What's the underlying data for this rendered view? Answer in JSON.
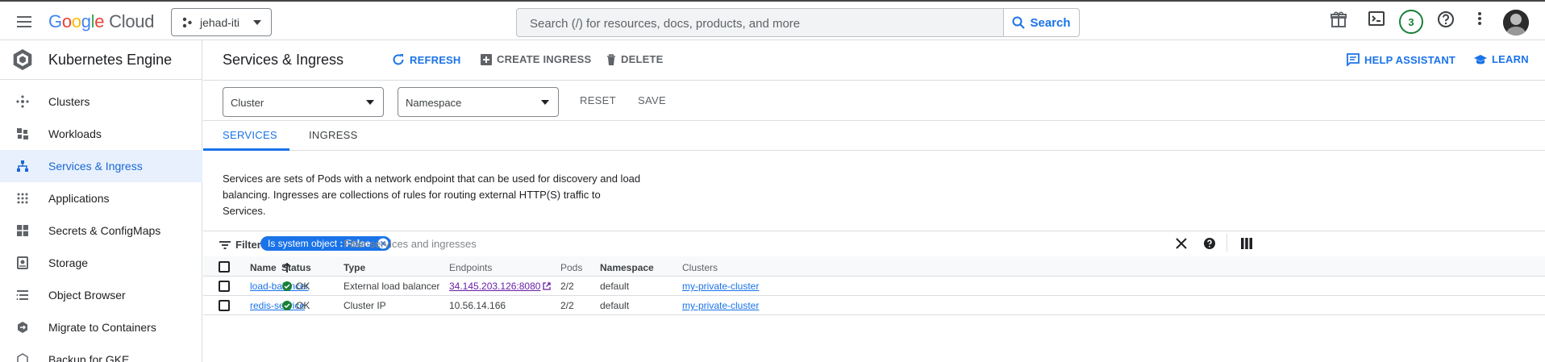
{
  "topbar": {
    "logo_parts": [
      "G",
      "o",
      "o",
      "g",
      "l",
      "e"
    ],
    "logo_cloud": "Cloud",
    "project": "jehad-iti",
    "search_placeholder": "Search (/) for resources, docs, products, and more",
    "search_button": "Search",
    "notification_count": "3"
  },
  "sidebar": {
    "title": "Kubernetes Engine",
    "items": [
      {
        "label": "Clusters",
        "icon": "clusters-icon"
      },
      {
        "label": "Workloads",
        "icon": "workloads-icon"
      },
      {
        "label": "Services & Ingress",
        "icon": "services-icon",
        "active": true
      },
      {
        "label": "Applications",
        "icon": "apps-grid-icon"
      },
      {
        "label": "Secrets & ConfigMaps",
        "icon": "secrets-icon"
      },
      {
        "label": "Storage",
        "icon": "storage-icon"
      },
      {
        "label": "Object Browser",
        "icon": "list-icon"
      },
      {
        "label": "Migrate to Containers",
        "icon": "migrate-icon"
      },
      {
        "label": "Backup for GKE",
        "icon": "backup-icon"
      }
    ]
  },
  "header": {
    "title": "Services & Ingress",
    "refresh": "REFRESH",
    "create_ingress": "CREATE INGRESS",
    "delete": "DELETE",
    "help_assistant": "HELP ASSISTANT",
    "learn": "LEARN"
  },
  "filters": {
    "cluster_placeholder": "Cluster",
    "namespace_placeholder": "Namespace",
    "reset": "RESET",
    "save": "SAVE"
  },
  "tabs": [
    {
      "label": "SERVICES",
      "active": true
    },
    {
      "label": "INGRESS",
      "active": false
    }
  ],
  "description": "Services are sets of Pods with a network endpoint that can be used for discovery and load balancing. Ingresses are collections of rules for routing external HTTP(S) traffic to Services.",
  "filter_bar": {
    "label": "Filter",
    "chip_key": "Is system object",
    "chip_sep": " : ",
    "chip_value": "False",
    "placeholder": "Filter services and ingresses"
  },
  "table": {
    "columns": [
      "Name",
      "Status",
      "Type",
      "Endpoints",
      "Pods",
      "Namespace",
      "Clusters"
    ],
    "rows": [
      {
        "name": "load-balancer",
        "status": "OK",
        "type": "External load balancer",
        "endpoints": "34.145.203.126:8080",
        "pods": "2/2",
        "namespace": "default",
        "cluster": "my-private-cluster"
      },
      {
        "name": "redis-service",
        "status": "OK",
        "type": "Cluster IP",
        "endpoints": "10.56.14.166",
        "pods": "2/2",
        "namespace": "default",
        "cluster": "my-private-cluster"
      }
    ]
  },
  "colors": {
    "accent": "#1a73e8",
    "status_ok": "#188038",
    "visited_link": "#681da8"
  }
}
